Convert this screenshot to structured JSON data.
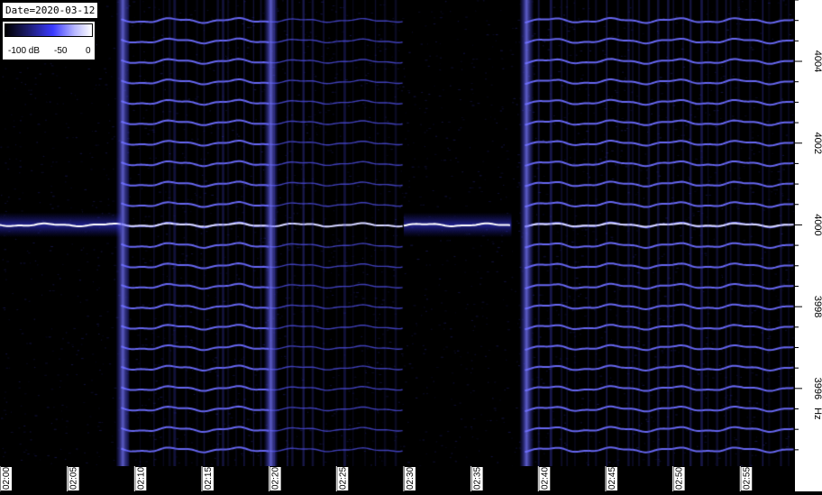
{
  "date_label": "Date=2020-03-12",
  "colorbar": {
    "ticks": [
      "-100 dB",
      "-50",
      "0"
    ],
    "colors": [
      "#000000",
      "#1a1a66",
      "#3a3aff",
      "#b7b7ff",
      "#ffffff"
    ]
  },
  "chart_data": {
    "type": "heatmap",
    "title": "",
    "xlabel": "",
    "ylabel": "Hz",
    "x_ticks": [
      "02:00",
      "02:05",
      "02:10",
      "02:15",
      "02:20",
      "02:25",
      "02:30",
      "02:35",
      "02:40",
      "02:45",
      "02:50",
      "02:55"
    ],
    "xlim": [
      "02:00",
      "02:59"
    ],
    "y_ticks": [
      3996,
      3998,
      4000,
      4002,
      4004
    ],
    "ylim": [
      3994.1,
      4005.5
    ],
    "carrier_hz": 4000,
    "sideband_spacing_hz": 0.5,
    "colormap": [
      "#000000",
      "#1a1a66",
      "#3a3aff",
      "#b7b7ff",
      "#ffffff"
    ],
    "segments": [
      {
        "name": "carrier only",
        "start": "02:00",
        "end": "02:09"
      },
      {
        "name": "modulated",
        "start": "02:09",
        "end": "02:20"
      },
      {
        "name": "weak modulated",
        "start": "02:20",
        "end": "02:30"
      },
      {
        "name": "carrier only",
        "start": "02:30",
        "end": "02:38"
      },
      {
        "name": "modulated",
        "start": "02:39",
        "end": "02:59"
      }
    ]
  }
}
